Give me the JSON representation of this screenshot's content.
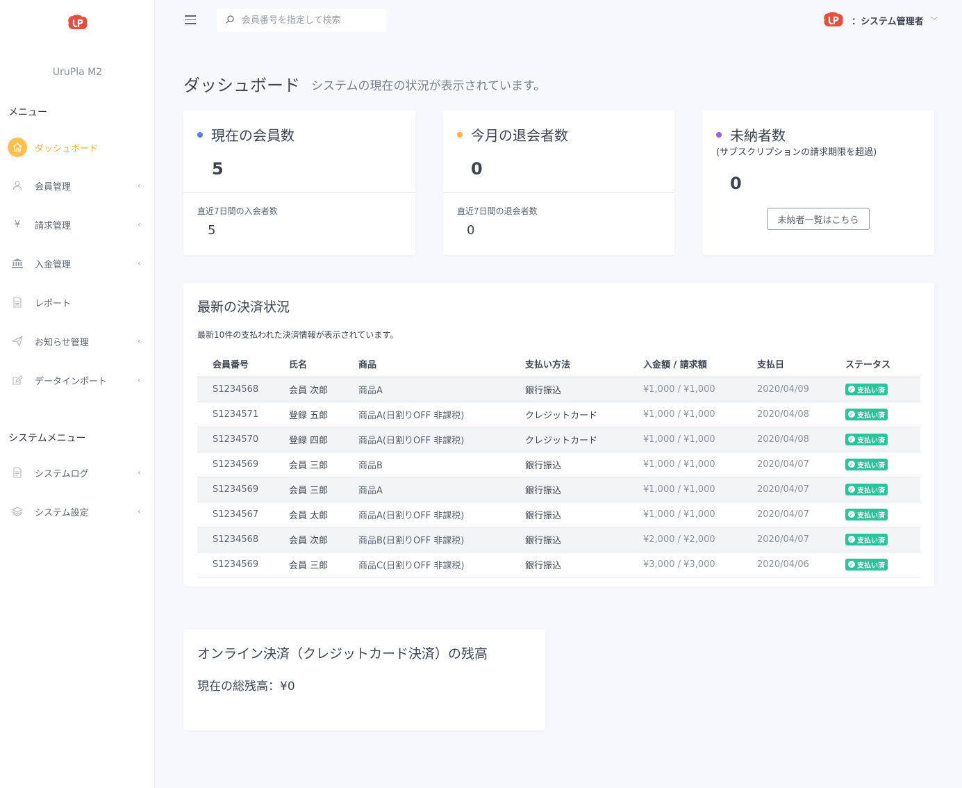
{
  "app": {
    "name": "UruPla M2"
  },
  "sidebar": {
    "menu_title": "メニュー",
    "system_menu_title": "システムメニュー",
    "items": [
      {
        "label": "ダッシュボード",
        "icon": "home-icon"
      },
      {
        "label": "会員管理",
        "icon": "user-icon"
      },
      {
        "label": "請求管理",
        "icon": "yen-icon"
      },
      {
        "label": "入金管理",
        "icon": "bank-icon"
      },
      {
        "label": "レポート",
        "icon": "document-icon"
      },
      {
        "label": "お知らせ管理",
        "icon": "send-icon"
      },
      {
        "label": "データインポート",
        "icon": "edit-icon"
      }
    ],
    "system_items": [
      {
        "label": "システムログ",
        "icon": "log-icon"
      },
      {
        "label": "システム設定",
        "icon": "layers-icon"
      }
    ],
    "chevron": "‹"
  },
  "header": {
    "search_placeholder": "会員番号を指定して検索",
    "user_label": "：システム管理者"
  },
  "page": {
    "title": "ダッシュボード",
    "subtitle": "システムの現在の状況が表示されています。"
  },
  "stats": {
    "members": {
      "title": "現在の会員数",
      "value": "5",
      "sub_label": "直近7日間の入会者数",
      "sub_value": "5",
      "color": "#5b7cf5"
    },
    "withdrawals": {
      "title": "今月の退会者数",
      "value": "0",
      "sub_label": "直近7日間の退会者数",
      "sub_value": "0",
      "color": "#ffb53b"
    },
    "unpaid": {
      "title": "未納者数",
      "note": "(サブスクリプションの請求期限を超過)",
      "value": "0",
      "button_label": "未納者一覧はこちら",
      "color": "#9b5de5"
    }
  },
  "payments": {
    "title": "最新の決済状況",
    "description": "最新10件の支払われた決済情報が表示されています。",
    "columns": [
      "会員番号",
      "氏名",
      "商品",
      "支払い方法",
      "入金額 / 請求額",
      "支払日",
      "ステータス"
    ],
    "rows": [
      [
        "S1234568",
        "会員 次郎",
        "商品A",
        "銀行振込",
        "¥1,000 / ¥1,000",
        "2020/04/09",
        "支払い済"
      ],
      [
        "S1234571",
        "登録 五郎",
        "商品A(日割りOFF 非課税)",
        "クレジットカード",
        "¥1,000 / ¥1,000",
        "2020/04/08",
        "支払い済"
      ],
      [
        "S1234570",
        "登録 四郎",
        "商品A(日割りOFF 非課税)",
        "クレジットカード",
        "¥1,000 / ¥1,000",
        "2020/04/08",
        "支払い済"
      ],
      [
        "S1234569",
        "会員 三郎",
        "商品B",
        "銀行振込",
        "¥1,000 / ¥1,000",
        "2020/04/07",
        "支払い済"
      ],
      [
        "S1234569",
        "会員 三郎",
        "商品A",
        "銀行振込",
        "¥1,000 / ¥1,000",
        "2020/04/07",
        "支払い済"
      ],
      [
        "S1234567",
        "会員 太郎",
        "商品A(日割りOFF 非課税)",
        "銀行振込",
        "¥1,000 / ¥1,000",
        "2020/04/07",
        "支払い済"
      ],
      [
        "S1234568",
        "会員 次郎",
        "商品B(日割りOFF 非課税)",
        "銀行振込",
        "¥2,000 / ¥2,000",
        "2020/04/07",
        "支払い済"
      ],
      [
        "S1234569",
        "会員 三郎",
        "商品C(日割りOFF 非課税)",
        "銀行振込",
        "¥3,000 / ¥3,000",
        "2020/04/06",
        "支払い済"
      ]
    ],
    "status_color": "#28c49c"
  },
  "balance": {
    "title": "オンライン決済（クレジットカード決済）の残高",
    "text": "現在の総残高：¥0"
  }
}
